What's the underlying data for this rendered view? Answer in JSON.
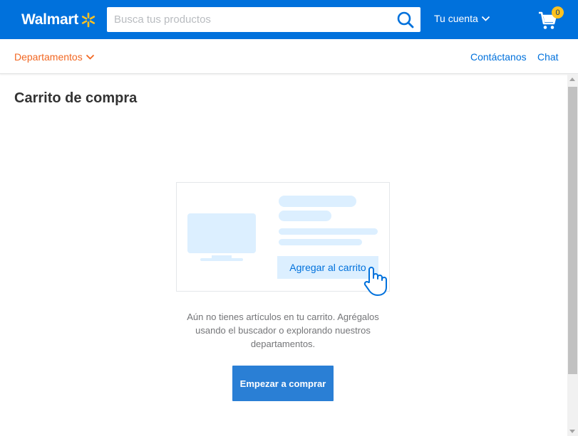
{
  "header": {
    "logo_text": "Walmart",
    "search_placeholder": "Busca tus productos",
    "account_label": "Tu cuenta",
    "cart_count": "0"
  },
  "subnav": {
    "departments_label": "Departamentos",
    "contact_label": "Contáctanos",
    "chat_label": "Chat"
  },
  "main": {
    "title": "Carrito de compra",
    "illustration_button_label": "Agregar al carrito",
    "empty_message": "Aún no tienes artículos en tu carrito. Agrégalos usando el buscador o explorando nuestros departamentos.",
    "start_button_label": "Empezar a comprar"
  },
  "colors": {
    "brand_blue": "#0071dc",
    "spark_yellow": "#ffc220",
    "accent_orange": "#f26722"
  },
  "icons": [
    "spark-logo-icon",
    "search-icon",
    "chevron-down-icon",
    "cart-icon",
    "tv-icon",
    "pointer-hand-icon"
  ]
}
